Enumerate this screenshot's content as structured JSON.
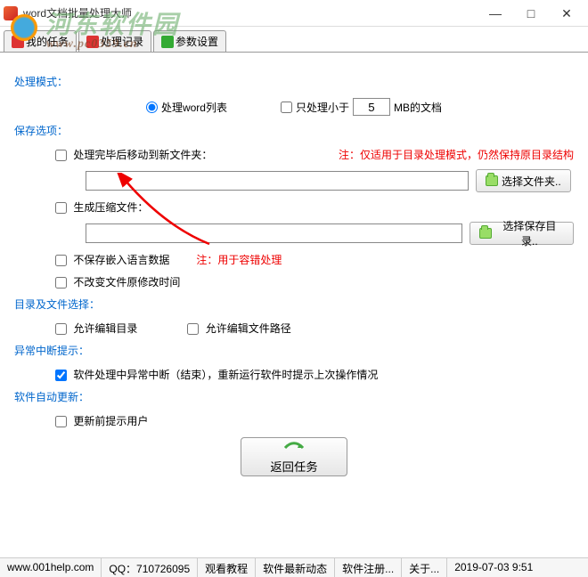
{
  "window": {
    "title": "word文档批量处理大师"
  },
  "tabs": {
    "t0": "我的任务",
    "t1": "处理记录",
    "t2": "参数设置"
  },
  "watermark": {
    "main": "河东软件园",
    "sub": "www.pc0359.cn"
  },
  "sections": {
    "mode": "处理模式：",
    "save": "保存选项：",
    "dir": "目录及文件选择：",
    "err": "异常中断提示：",
    "update": "软件自动更新："
  },
  "mode": {
    "radio_list": "处理word列表",
    "size_cb": "只处理小于",
    "size_val": "5",
    "size_suffix": "MB的文档"
  },
  "save": {
    "move_cb": "处理完毕后移动到新文件夹：",
    "move_note": "注：仅适用于目录处理模式，仍然保持原目录结构",
    "move_path": "",
    "move_btn": "选择文件夹..",
    "zip_cb": "生成压缩文件：",
    "zip_path": "",
    "zip_btn": "选择保存目录..",
    "nolang_cb": "不保存嵌入语言数据",
    "nolang_note": "注：用于容错处理",
    "keeptime_cb": "不改变文件原修改时间"
  },
  "dir": {
    "editdir_cb": "允许编辑目录",
    "editpath_cb": "允许编辑文件路径"
  },
  "err": {
    "resume_cb": "软件处理中异常中断（结束），重新运行软件时提示上次操作情况"
  },
  "update": {
    "prompt_cb": "更新前提示用户"
  },
  "return_btn": "返回任务",
  "status": {
    "s0": "www.001help.com",
    "s1": "QQ：710726095",
    "s2": "观看教程",
    "s3": "软件最新动态",
    "s4": "软件注册...",
    "s5": "关于...",
    "s6": "2019-07-03  9:51"
  }
}
